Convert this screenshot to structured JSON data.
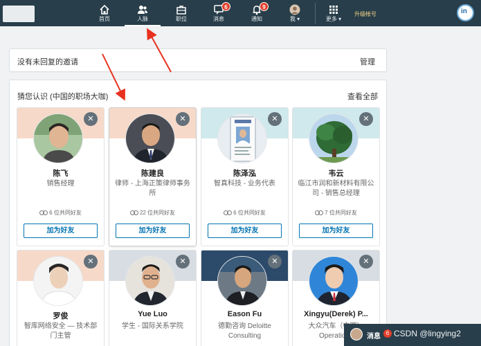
{
  "nav": {
    "items": [
      {
        "label": "首页",
        "icon": "home-icon"
      },
      {
        "label": "人脉",
        "icon": "people-icon",
        "active": true
      },
      {
        "label": "职位",
        "icon": "briefcase-icon"
      },
      {
        "label": "消息",
        "icon": "chat-icon",
        "badge": "6"
      },
      {
        "label": "通知",
        "icon": "bell-icon",
        "badge": "9"
      },
      {
        "label": "我",
        "icon": "avatar-icon"
      },
      {
        "label": "更多",
        "icon": "grid-icon"
      }
    ],
    "upgrade": "升级帐号"
  },
  "invitations": {
    "title": "没有未回复的邀请",
    "manage": "管理"
  },
  "suggestions": {
    "title": "猜您认识 (中国的职场大咖)",
    "view_all": "查看全部",
    "close_glyph": "✕",
    "people": [
      {
        "name": "陈飞",
        "desc": "销售经理",
        "mutual": "6 位共同好友",
        "action": "加为好友",
        "banner": "#f6d9c9"
      },
      {
        "name": "陈建良",
        "desc": "律师 - 上海正策律师事务所",
        "mutual": "22 位共同好友",
        "action": "加为好友",
        "banner": "#f6d9c9"
      },
      {
        "name": "陈泽泓",
        "desc": "智真科技 - 业务代表",
        "mutual": "6 位共同好友",
        "action": "加为好友",
        "banner": "#cfe9ec"
      },
      {
        "name": "韦云",
        "desc": "临江市润和新材料有限公司 - 销售总经理",
        "mutual": "7 位共同好友",
        "action": "加为好友",
        "banner": "#cfe9ec"
      },
      {
        "name": "罗俊",
        "desc": "智库网络安全 — 技术部门主管",
        "banner": "#f6d9c9"
      },
      {
        "name": "Yue Luo",
        "desc": "学生 - 国际关系学院",
        "banner": "#d7dde2"
      },
      {
        "name": "Eason Fu",
        "desc": "德勤咨询 Deloitte Consulting",
        "banner": "#2c4a6a"
      },
      {
        "name": "Xingyu(Derek) P...",
        "desc": "大众汽车（中国）Operations",
        "banner": "#d7dde2"
      }
    ]
  },
  "messaging": {
    "label": "消息",
    "badge": "6",
    "watermark": "CSDN @lingying2"
  }
}
